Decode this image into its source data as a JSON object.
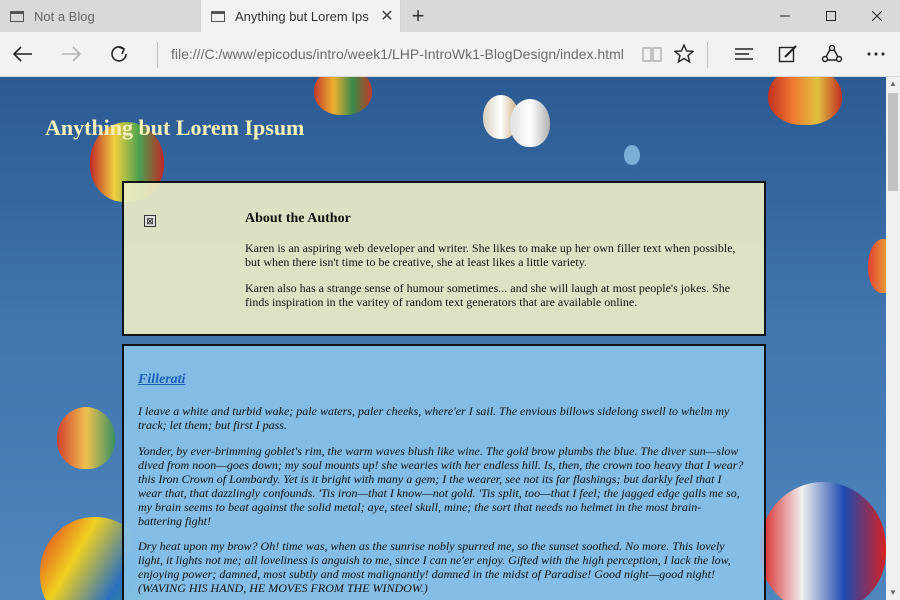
{
  "tabs": [
    {
      "label": "Not a Blog",
      "active": false
    },
    {
      "label": "Anything but Lorem Ips",
      "active": true
    }
  ],
  "window_controls": [
    "minimize-icon",
    "maximize-icon",
    "close-icon"
  ],
  "toolbar": {
    "address": "file:///C:/www/epicodus/intro/week1/LHP-IntroWk1-BlogDesign/index.html",
    "icons": [
      "back-icon",
      "forward-icon",
      "refresh-icon",
      "reading-view-icon",
      "favorite-star-icon",
      "hub-icon",
      "web-note-icon",
      "share-icon",
      "more-icon"
    ]
  },
  "page": {
    "site_title": "Anything but Lorem Ipsum",
    "author": {
      "heading": "About the Author",
      "p1": "Karen is an aspiring web developer and writer. She likes to make up her own filler text when possible, but when there isn't time to be creative, she at least likes a little variety.",
      "p2": "Karen also has a strange sense of humour sometimes... and she will laugh at most people's jokes. She finds inspiration in the varitey of random text generators that are available online."
    },
    "post": {
      "title": "Fillerati",
      "p1": "I leave a white and turbid wake; pale waters, paler cheeks, where'er I sail. The envious billows sidelong swell to whelm my track; let them; but first I pass.",
      "p2": "Yonder, by ever-brimming goblet's rim, the warm waves blush like wine. The gold brow plumbs the blue. The diver sun—slow dived from noon—goes down; my soul mounts up! she wearies with her endless hill. Is, then, the crown too heavy that I wear? this Iron Crown of Lombardy. Yet is it bright with many a gem; I the wearer, see not its far flashings; but darkly feel that I wear that, that dazzlingly confounds. 'Tis iron—that I know—not gold. 'Tis split, too—that I feel; the jagged edge galls me so, my brain seems to beat against the solid metal; aye, steel skull, mine; the sort that needs no helmet in the most brain-battering fight!",
      "p3": "Dry heat upon my brow? Oh! time was, when as the sunrise nobly spurred me, so the sunset soothed. No more. This lovely light, it lights not me; all loveliness is anguish to me, since I can ne'er enjoy. Gifted with the high perception, I lack the low, enjoying power; damned, most subtly and most malignantly! damned in the midst of Paradise! Good night—good night! (WAVING HIS HAND, HE MOVES FROM THE WINDOW.)"
    }
  },
  "colors": {
    "title": "#f5f0b8",
    "author_bg": "#f0eec8",
    "post_bg": "#8cc6ec",
    "link": "#1d5fb8",
    "sky": "#3f74ad"
  }
}
